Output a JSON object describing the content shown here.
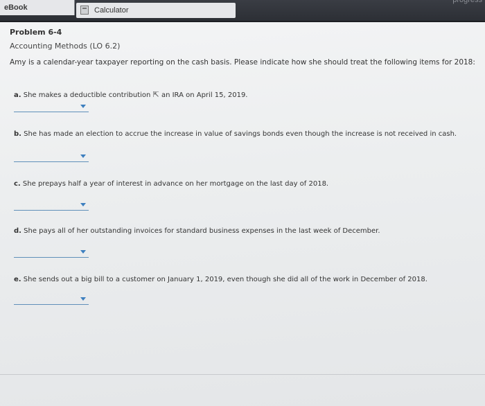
{
  "tabs": {
    "ebook": "eBook",
    "calculator": "Calculator",
    "progress": "progress"
  },
  "problem": {
    "title": "Problem 6-4",
    "subtitle": "Accounting Methods (LO 6.2)",
    "intro": "Amy is a calendar-year taxpayer reporting on the cash basis. Please indicate how she should treat the following items for 2018:"
  },
  "items": [
    {
      "letter": "a.",
      "text_before": "She makes a deductible contribution",
      "text_after": "an IRA on April 15, 2019."
    },
    {
      "letter": "b.",
      "text": "She has made an election to accrue the increase in value of savings bonds even though the increase is not received in cash."
    },
    {
      "letter": "c.",
      "text": "She prepays half a year of interest in advance on her mortgage on the last day of 2018."
    },
    {
      "letter": "d.",
      "text": "She pays all of her outstanding invoices for standard business expenses in the last week of December."
    },
    {
      "letter": "e.",
      "text": "She sends out a big bill to a customer on January 1, 2019, even though she did all of the work in December of 2018."
    }
  ],
  "dropdowns": [
    {
      "value": ""
    },
    {
      "value": ""
    },
    {
      "value": ""
    },
    {
      "value": ""
    },
    {
      "value": ""
    }
  ]
}
